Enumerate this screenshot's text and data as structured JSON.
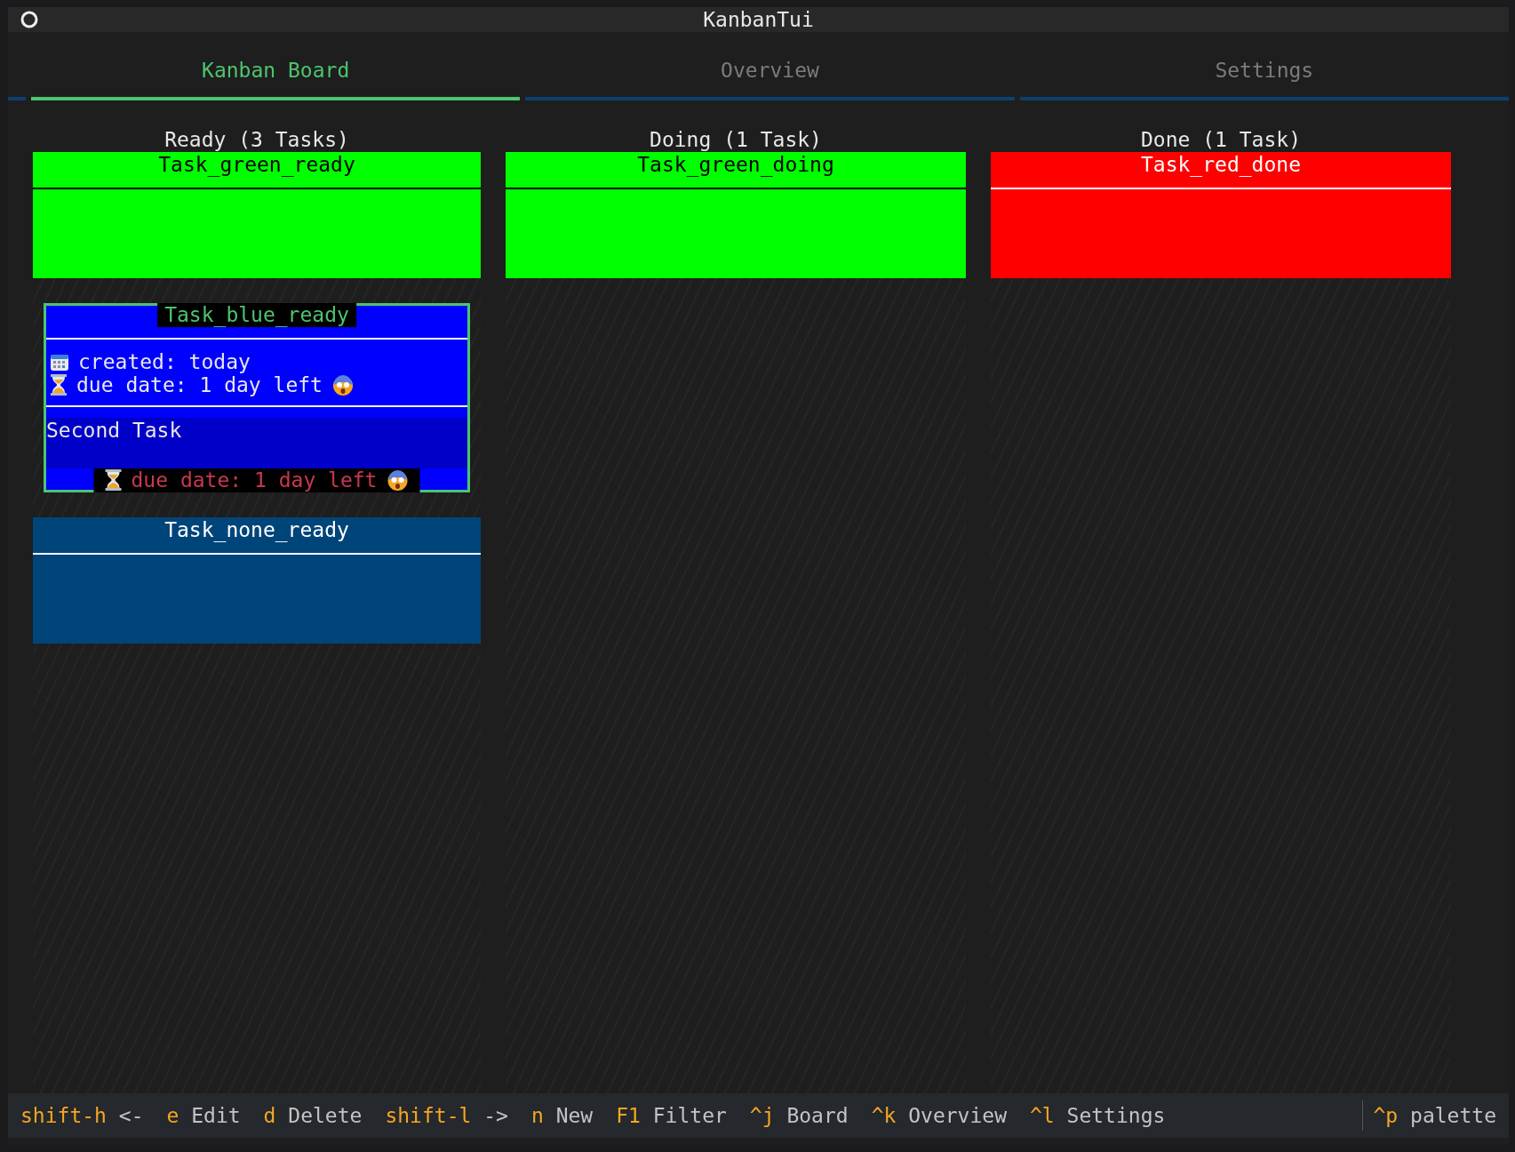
{
  "window": {
    "title": "KanbanTui"
  },
  "tabs": [
    {
      "label": "Kanban Board",
      "selected": true
    },
    {
      "label": "Overview",
      "selected": false
    },
    {
      "label": "Settings",
      "selected": false
    }
  ],
  "columns": [
    {
      "title": "Ready (3 Tasks)",
      "cards": [
        {
          "title": "Task_green_ready",
          "color": "#00ff00",
          "selected": false
        },
        {
          "title": "Task_blue_ready",
          "color": "#0000ff",
          "selected": true,
          "details": [
            {
              "kind": "created",
              "text": "created: today"
            },
            {
              "kind": "due",
              "text": "due date: 1 day left"
            }
          ],
          "description": "Second Task",
          "footer": "due date: 1 day left"
        },
        {
          "title": "Task_none_ready",
          "color": "#00457a",
          "selected": false
        }
      ]
    },
    {
      "title": "Doing (1 Task)",
      "cards": [
        {
          "title": "Task_green_doing",
          "color": "#00ff00",
          "selected": false
        }
      ]
    },
    {
      "title": "Done (1 Task)",
      "cards": [
        {
          "title": "Task_red_done",
          "color": "#ff0000",
          "selected": false
        }
      ]
    }
  ],
  "footer": {
    "bindings": [
      {
        "key": "shift-h",
        "description": "<-"
      },
      {
        "key": "e",
        "description": "Edit"
      },
      {
        "key": "d",
        "description": "Delete"
      },
      {
        "key": "shift-l",
        "description": "->"
      },
      {
        "key": "n",
        "description": "New"
      },
      {
        "key": "F1",
        "description": "Filter"
      },
      {
        "key": "^j",
        "description": "Board"
      },
      {
        "key": "^k",
        "description": "Overview"
      },
      {
        "key": "^l",
        "description": "Settings"
      }
    ],
    "palette": {
      "key": "^p",
      "description": "palette"
    }
  }
}
